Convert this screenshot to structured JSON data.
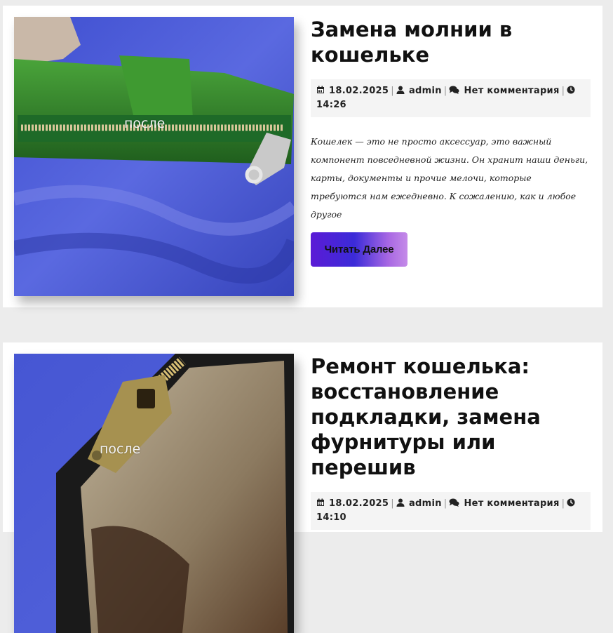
{
  "posts": [
    {
      "image_caption": "после",
      "title": "Замена молнии в кошельке",
      "date": "18.02.2025",
      "author": "admin",
      "comments": "Нет комментария",
      "time": "14:26",
      "excerpt": "Кошелек — это не просто аксессуар, это важный компонент повседневной жизни. Он хранит наши деньги, карты, документы и прочие мелочи, которые требуются нам ежедневно. К сожалению, как и любое другое",
      "read_more": "Читать Далее"
    },
    {
      "image_caption": "после",
      "title": "Ремонт кошелька: восстановление подкладки, замена фурнитуры или перешив",
      "date": "18.02.2025",
      "author": "admin",
      "comments": "Нет комментария",
      "time": "14:10"
    }
  ],
  "icons": {
    "date": "calendar-icon",
    "author": "user-icon",
    "comments": "comments-icon",
    "time": "clock-icon"
  },
  "colors": {
    "page_background": "#ececec",
    "card_background": "#ffffff",
    "meta_background": "#f4f4f4",
    "button_gradient_start": "#5b1bd6",
    "button_gradient_end": "#c58be8"
  }
}
